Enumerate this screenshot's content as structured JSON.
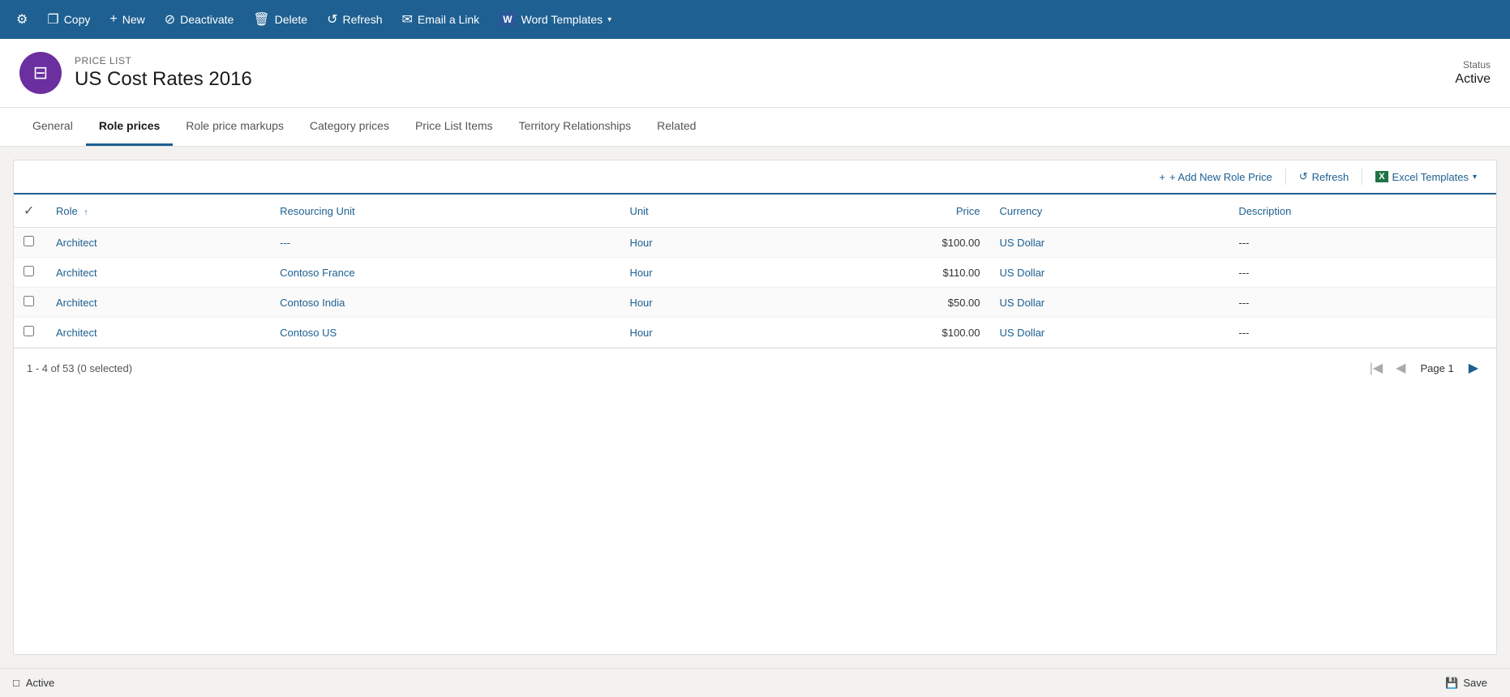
{
  "toolbar": {
    "buttons": [
      {
        "id": "settings",
        "label": "",
        "icon": "⚙",
        "isIcon": true
      },
      {
        "id": "copy",
        "label": "Copy",
        "icon": "❐"
      },
      {
        "id": "new",
        "label": "New",
        "icon": "+"
      },
      {
        "id": "deactivate",
        "label": "Deactivate",
        "icon": "⊘"
      },
      {
        "id": "delete",
        "label": "Delete",
        "icon": "🗑"
      },
      {
        "id": "refresh",
        "label": "Refresh",
        "icon": "↺"
      },
      {
        "id": "email",
        "label": "Email a Link",
        "icon": "✉"
      },
      {
        "id": "word",
        "label": "Word Templates",
        "icon": "W",
        "hasDropdown": true
      }
    ]
  },
  "entity": {
    "icon": "☰",
    "label": "PRICE LIST",
    "name": "US Cost Rates 2016",
    "statusLabel": "Status",
    "statusValue": "Active"
  },
  "tabs": [
    {
      "id": "general",
      "label": "General",
      "active": false
    },
    {
      "id": "role-prices",
      "label": "Role prices",
      "active": true
    },
    {
      "id": "role-price-markups",
      "label": "Role price markups",
      "active": false
    },
    {
      "id": "category-prices",
      "label": "Category prices",
      "active": false
    },
    {
      "id": "price-list-items",
      "label": "Price List Items",
      "active": false
    },
    {
      "id": "territory-relationships",
      "label": "Territory Relationships",
      "active": false
    },
    {
      "id": "related",
      "label": "Related",
      "active": false
    }
  ],
  "tableToolbar": {
    "addLabel": "+ Add New Role Price",
    "refreshLabel": "Refresh",
    "excelLabel": "Excel Templates",
    "refreshIcon": "↺",
    "excelIcon": "X"
  },
  "table": {
    "columns": [
      {
        "id": "check",
        "label": "",
        "type": "check"
      },
      {
        "id": "role",
        "label": "Role",
        "sortable": true
      },
      {
        "id": "resourcing-unit",
        "label": "Resourcing Unit"
      },
      {
        "id": "unit",
        "label": "Unit"
      },
      {
        "id": "price",
        "label": "Price",
        "align": "right"
      },
      {
        "id": "currency",
        "label": "Currency"
      },
      {
        "id": "description",
        "label": "Description"
      }
    ],
    "rows": [
      {
        "role": "Architect",
        "resourcingUnit": "---",
        "unit": "Hour",
        "price": "$100.00",
        "currency": "US Dollar",
        "description": "---"
      },
      {
        "role": "Architect",
        "resourcingUnit": "Contoso France",
        "unit": "Hour",
        "price": "$110.00",
        "currency": "US Dollar",
        "description": "---"
      },
      {
        "role": "Architect",
        "resourcingUnit": "Contoso India",
        "unit": "Hour",
        "price": "$50.00",
        "currency": "US Dollar",
        "description": "---"
      },
      {
        "role": "Architect",
        "resourcingUnit": "Contoso US",
        "unit": "Hour",
        "price": "$100.00",
        "currency": "US Dollar",
        "description": "---"
      }
    ]
  },
  "pagination": {
    "summary": "1 - 4 of 53 (0 selected)",
    "pageLabel": "Page 1"
  },
  "statusBar": {
    "status": "Active",
    "saveLabel": "Save",
    "saveIcon": "💾"
  }
}
